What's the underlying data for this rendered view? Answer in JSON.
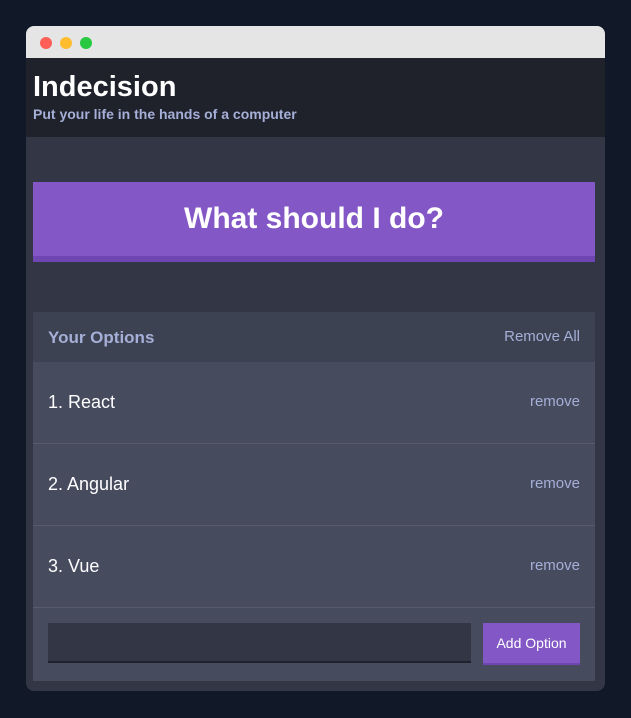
{
  "window": {
    "controls": [
      "close",
      "minimize",
      "maximize"
    ]
  },
  "header": {
    "title": "Indecision",
    "subtitle": "Put your life in the hands of a computer"
  },
  "action": {
    "label": "What should I do?"
  },
  "options": {
    "title": "Your Options",
    "remove_all_label": "Remove All",
    "items": [
      {
        "text": "1. React",
        "remove_label": "remove"
      },
      {
        "text": "2. Angular",
        "remove_label": "remove"
      },
      {
        "text": "3. Vue",
        "remove_label": "remove"
      }
    ]
  },
  "add_option": {
    "input_value": "",
    "button_label": "Add Option"
  },
  "colors": {
    "accent": "#8357c5",
    "header_bg": "#20222b",
    "body_bg": "#333645",
    "panel_bg": "#464b5e",
    "muted_text": "#a5afd7"
  }
}
